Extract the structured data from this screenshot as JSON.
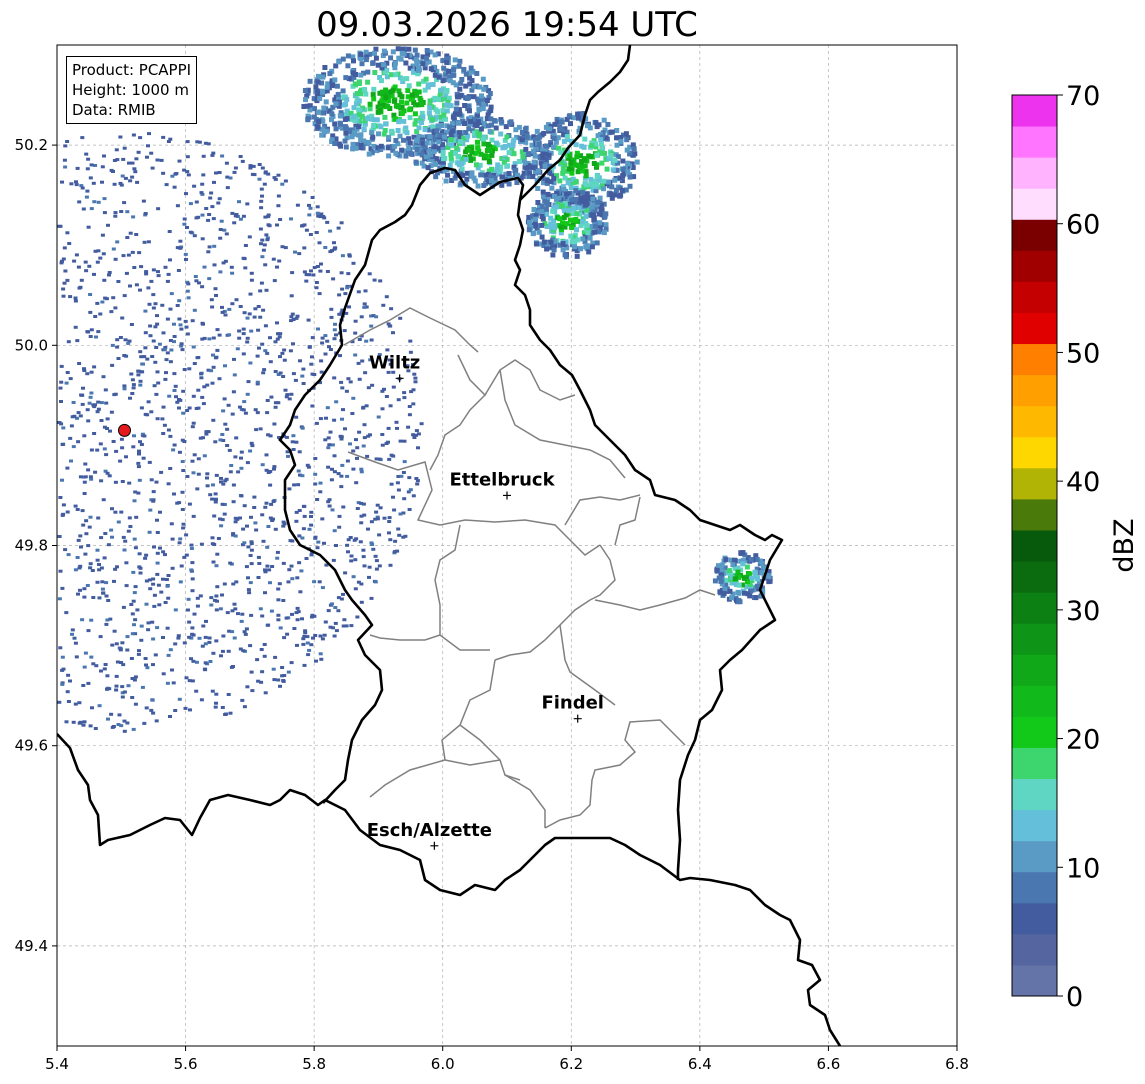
{
  "title": "09.03.2026 19:54 UTC",
  "info": {
    "product": "Product: PCAPPI",
    "height": "Height: 1000 m",
    "data": "Data: RMIB"
  },
  "map": {
    "xlim": [
      5.4,
      6.8
    ],
    "ylim": [
      49.3,
      50.3
    ],
    "x_ticks": [
      "5.4",
      "5.6",
      "5.8",
      "6.0",
      "6.2",
      "6.4",
      "6.6",
      "6.8"
    ],
    "y_ticks": [
      "49.4",
      "49.6",
      "49.8",
      "50.0",
      "50.2"
    ],
    "grid": true,
    "radar_site": {
      "lon": 5.505,
      "lat": 49.915,
      "color": "#e41a1c"
    },
    "places": [
      {
        "name": "Wiltz",
        "lon": 5.933,
        "lat": 49.967
      },
      {
        "name": "Ettelbruck",
        "lon": 6.1,
        "lat": 49.85
      },
      {
        "name": "Findel",
        "lon": 6.21,
        "lat": 49.627
      },
      {
        "name": "Esch/Alzette",
        "lon": 5.987,
        "lat": 49.5
      }
    ]
  },
  "colorbar": {
    "label": "dBZ",
    "min": 0,
    "max": 70,
    "ticks": [
      "0",
      "10",
      "20",
      "30",
      "40",
      "50",
      "60",
      "70"
    ],
    "colors": [
      "#6574a8",
      "#5465a0",
      "#435c9f",
      "#4b77b0",
      "#5a9bc6",
      "#64c0da",
      "#5fd6c4",
      "#3dd56e",
      "#12c91a",
      "#12b91a",
      "#10a818",
      "#0e9416",
      "#0c8012",
      "#0a6b0f",
      "#075a0c",
      "#4a7a0a",
      "#b1b305",
      "#ffd700",
      "#ffb800",
      "#ff9f00",
      "#ff7f00",
      "#e00000",
      "#c40000",
      "#a10000",
      "#7a0000",
      "#ffddff",
      "#ffb3ff",
      "#ff75ff",
      "#ee33ee"
    ]
  }
}
